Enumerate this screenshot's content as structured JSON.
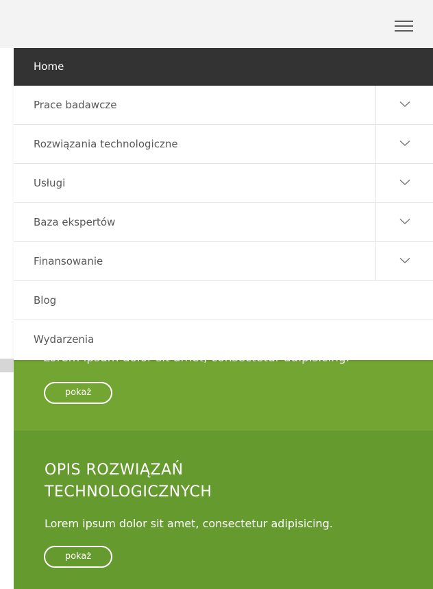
{
  "header": {
    "menu_icon": "hamburger-menu-icon"
  },
  "nav": {
    "home_label": "Home",
    "items": [
      {
        "label": "Prace badawcze",
        "has_submenu": true,
        "icon": "chevron-down-icon"
      },
      {
        "label": "Rozwiązania technologiczne",
        "has_submenu": true,
        "icon": "chevron-down-icon"
      },
      {
        "label": "Usługi",
        "has_submenu": true,
        "icon": "chevron-down-icon"
      },
      {
        "label": "Baza ekspertów",
        "has_submenu": true,
        "icon": "chevron-down-icon"
      },
      {
        "label": "Finansowanie",
        "has_submenu": true,
        "icon": "chevron-down-icon"
      },
      {
        "label": "Blog",
        "has_submenu": false
      },
      {
        "label": "Wydarzenia",
        "has_submenu": false
      }
    ]
  },
  "blocks": [
    {
      "text": "Lorem ipsum dolor sit amet, consectetur adipisicing.",
      "button_label": "pokaż"
    },
    {
      "title_line1": "OPIS ROZWIĄZAŃ",
      "title_line2": "TECHNOLOGICZNYCH",
      "text": "Lorem ipsum dolor sit amet, consectetur adipisicing.",
      "button_label": "pokaż"
    }
  ],
  "colors": {
    "nav_active_bg": "#333333",
    "green_primary": "#73a532",
    "green_secondary": "#659a2f",
    "top_bar_bg": "#f3f3f3"
  }
}
